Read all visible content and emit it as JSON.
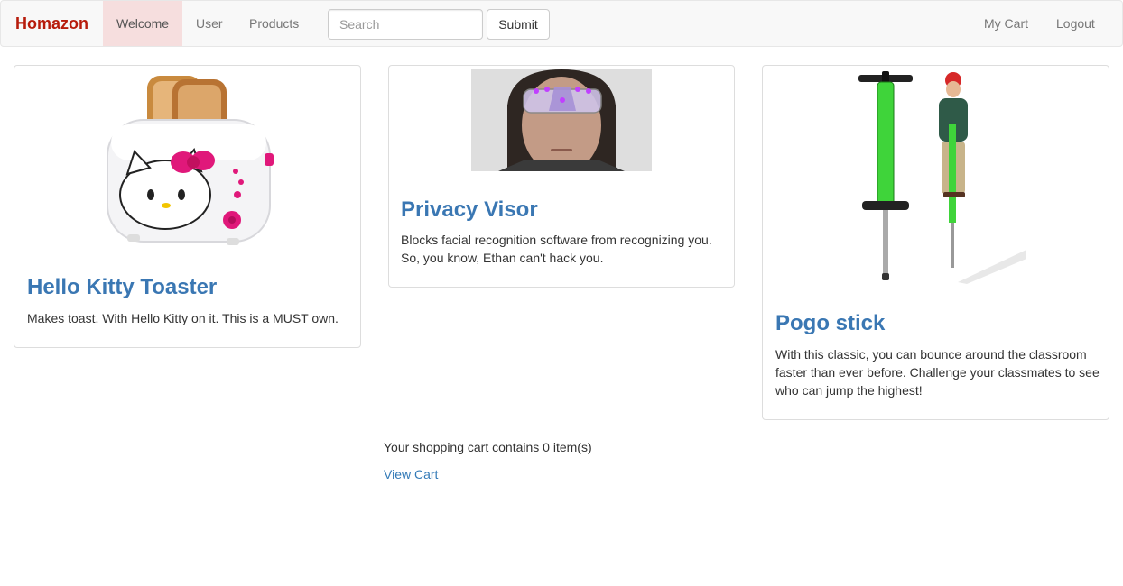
{
  "nav": {
    "brand": "Homazon",
    "links": [
      {
        "label": "Welcome",
        "active": true
      },
      {
        "label": "User",
        "active": false
      },
      {
        "label": "Products",
        "active": false
      }
    ],
    "search_placeholder": "Search",
    "submit_label": "Submit",
    "right_links": [
      {
        "label": "My Cart"
      },
      {
        "label": "Logout"
      }
    ]
  },
  "products": [
    {
      "title": "Hello Kitty Toaster",
      "description": "Makes toast. With Hello Kitty on it. This is a MUST own.",
      "image_icon": "toaster-image"
    },
    {
      "title": "Privacy Visor",
      "description": "Blocks facial recognition software from recognizing you. So, you know, Ethan can't hack you.",
      "image_icon": "visor-person-image"
    },
    {
      "title": "Pogo stick",
      "description": "With this classic, you can bounce around the classroom faster than ever before. Challenge your classmates to see who can jump the highest!",
      "image_icon": "pogo-stick-image"
    }
  ],
  "cart": {
    "summary": "Your shopping cart contains 0 item(s)",
    "view_label": "View Cart"
  },
  "colors": {
    "brand": "#b71c0c",
    "link": "#337ab7",
    "active_nav": "#f6dede"
  }
}
